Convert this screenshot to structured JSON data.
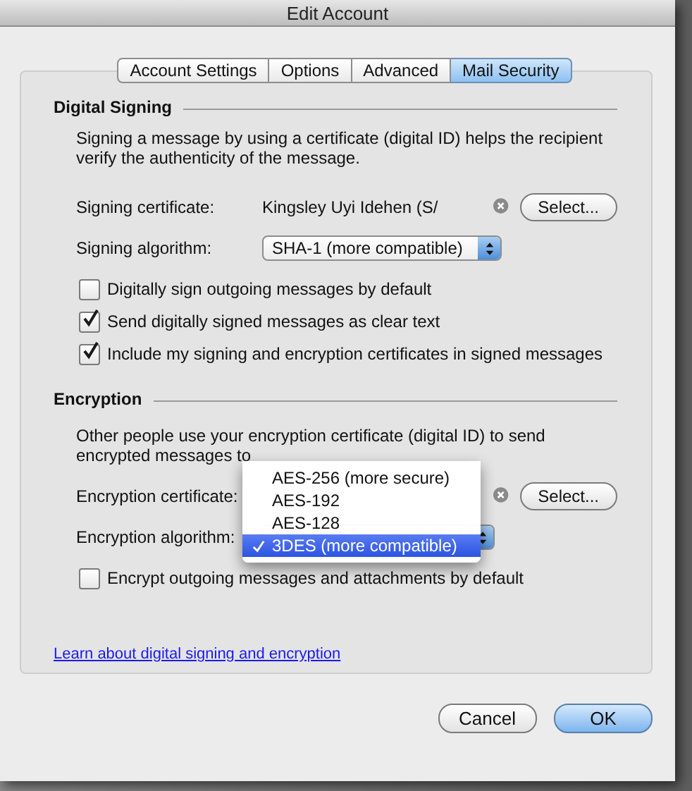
{
  "window": {
    "title": "Edit Account"
  },
  "tabs": [
    {
      "label": "Account Settings",
      "selected": false
    },
    {
      "label": "Options",
      "selected": false
    },
    {
      "label": "Advanced",
      "selected": false
    },
    {
      "label": "Mail Security",
      "selected": true
    }
  ],
  "signing": {
    "heading": "Digital Signing",
    "description": "Signing a message by using a certificate (digital ID) helps the recipient verify the authenticity of the message.",
    "certificate": {
      "label": "Signing certificate:",
      "value": "Kingsley Uyi Idehen (S/",
      "button": "Select..."
    },
    "algorithm": {
      "label": "Signing algorithm:",
      "value": "SHA-1 (more compatible)"
    },
    "options": [
      {
        "label": "Digitally sign outgoing messages by default",
        "checked": false
      },
      {
        "label": "Send digitally signed messages as clear text",
        "checked": true
      },
      {
        "label": "Include my signing and encryption certificates in signed messages",
        "checked": true
      }
    ]
  },
  "encryption": {
    "heading": "Encryption",
    "description": "Other people use your encryption certificate (digital ID) to send encrypted messages to",
    "certificate": {
      "label": "Encryption certificate:",
      "button": "Select..."
    },
    "algorithm": {
      "label": "Encryption algorithm:",
      "menu": [
        {
          "label": "AES-256 (more secure)",
          "selected": false
        },
        {
          "label": "AES-192",
          "selected": false
        },
        {
          "label": "AES-128",
          "selected": false
        },
        {
          "label": "3DES (more compatible)",
          "selected": true
        }
      ]
    },
    "options": [
      {
        "label": "Encrypt outgoing messages and attachments by default",
        "checked": false
      }
    ]
  },
  "link": "Learn about digital signing and encryption",
  "buttons": [
    {
      "label": "Cancel",
      "default": false
    },
    {
      "label": "OK",
      "default": true
    }
  ]
}
